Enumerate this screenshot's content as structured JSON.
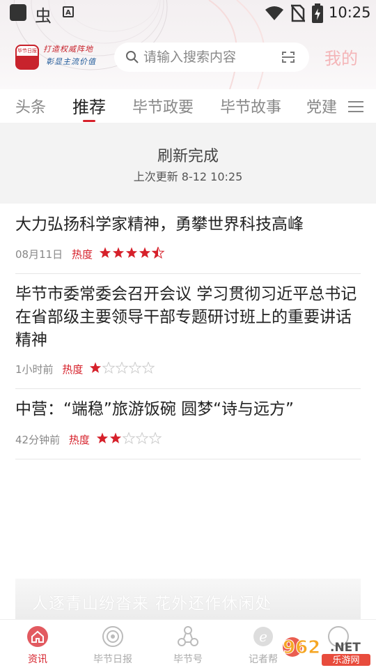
{
  "status_bar": {
    "time": "10:25",
    "notice_letter": "A"
  },
  "header": {
    "logo_text": "毕节日报",
    "slogan": [
      "打造权威阵地",
      "彰显主流价值"
    ],
    "search": {
      "placeholder": "请输入搜索内容"
    },
    "mine_label": "我的"
  },
  "tabs": [
    "头条",
    "推荐",
    "毕节政要",
    "毕节故事",
    "党建"
  ],
  "active_tab": "推荐",
  "refresh": {
    "title": "刷新完成",
    "last_update": "上次更新 8-12 10:25"
  },
  "heat_label": "热度",
  "news": [
    {
      "title": "大力弘扬科学家精神，勇攀世界科技高峰",
      "time": "08月11日",
      "heat_stars": 4.5
    },
    {
      "title": "毕节市委常委会召开会议 学习贯彻习近平总书记在省部级主要领导干部专题研讨班上的重要讲话精神",
      "time": "1小时前",
      "heat_stars": 1
    },
    {
      "title": "中营：“端稳”旅游饭碗 圆梦“诗与远方”",
      "time": "42分钟前",
      "heat_stars": 2
    }
  ],
  "banner": {
    "text": "人逐青山纷沓来 花外还作休闲处"
  },
  "bottom_nav": [
    {
      "label": "资讯",
      "icon": "home-icon"
    },
    {
      "label": "毕节日报",
      "icon": "newspaper-icon"
    },
    {
      "label": "毕节号",
      "icon": "molecule-icon"
    },
    {
      "label": "记者帮",
      "icon": "e-icon"
    },
    {
      "label": "",
      "icon": "target-icon"
    }
  ],
  "watermark": {
    "brand": "962",
    "suffix": ".NET",
    "caption": "乐游网"
  },
  "colors": {
    "accent": "#d6202a",
    "mine": "#f4b5b8",
    "slogan_red": "#c8232c",
    "slogan_blue": "#1f5a9a"
  }
}
